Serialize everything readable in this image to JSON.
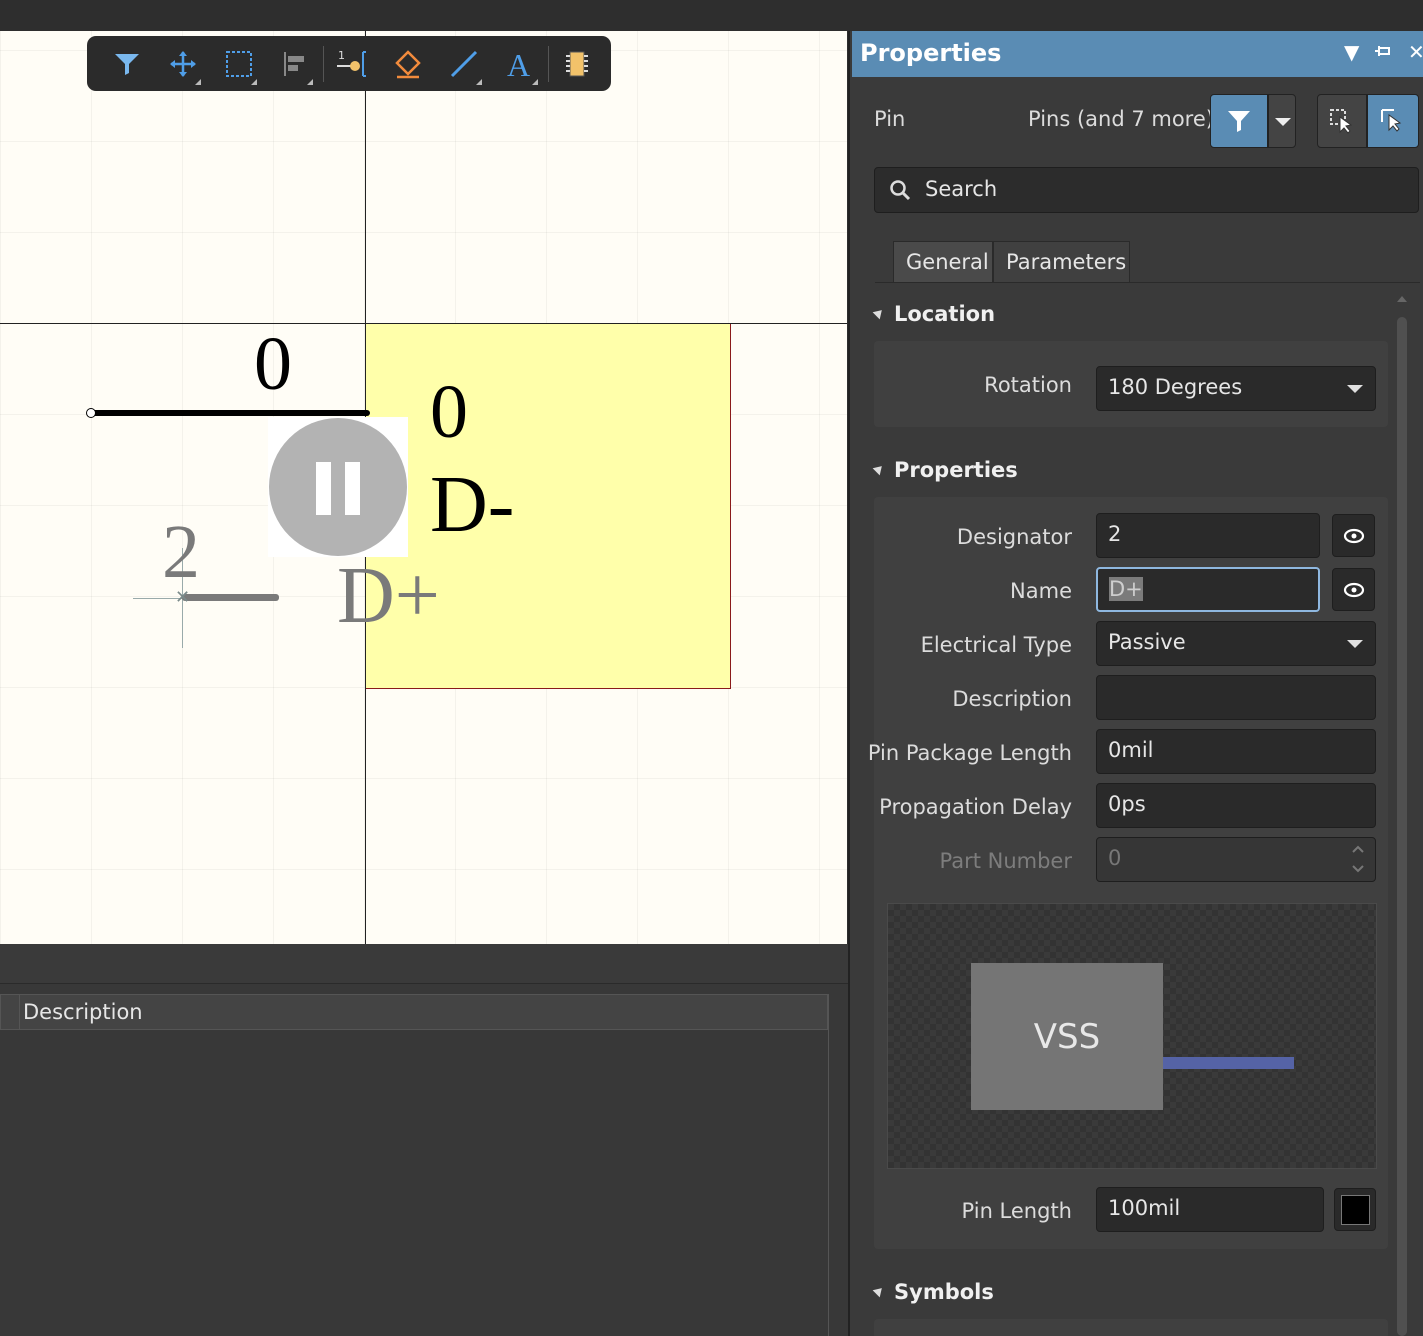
{
  "canvas": {
    "pin_top_number": "0",
    "designator": "0",
    "pin_name": "D-",
    "ghost_designator": "2",
    "ghost_name": "D+"
  },
  "toolbar": {
    "tools": [
      "filter-icon",
      "move-icon",
      "select-rect-icon",
      "align-icon",
      "place-pin-icon",
      "port-icon",
      "line-icon",
      "text-icon",
      "component-icon"
    ],
    "accent_color": "#4f9ee8"
  },
  "bottom_panel": {
    "column_header": "Description"
  },
  "properties": {
    "title": "Properties",
    "object_type": "Pin",
    "selection_text": "Pins (and 7 more)",
    "search_placeholder": "Search",
    "tabs": [
      "General",
      "Parameters"
    ],
    "sections": {
      "location": "Location",
      "properties": "Properties",
      "symbols": "Symbols"
    },
    "rotation_label": "Rotation",
    "rotation_value": "180 Degrees",
    "designator_label": "Designator",
    "designator_value": "2",
    "name_label": "Name",
    "name_value": "D+",
    "electrical_type_label": "Electrical Type",
    "electrical_type_value": "Passive",
    "description_label": "Description",
    "description_value": "",
    "pin_package_length_label": "Pin Package Length",
    "pin_package_length_value": "0mil",
    "propagation_delay_label": "Propagation Delay",
    "propagation_delay_value": "0ps",
    "part_number_label": "Part Number",
    "part_number_value": "0",
    "preview_text": "VSS",
    "pin_length_label": "Pin Length",
    "pin_length_value": "100mil",
    "pin_color": "#000000",
    "title_bar_color": "#5a8cb4"
  }
}
